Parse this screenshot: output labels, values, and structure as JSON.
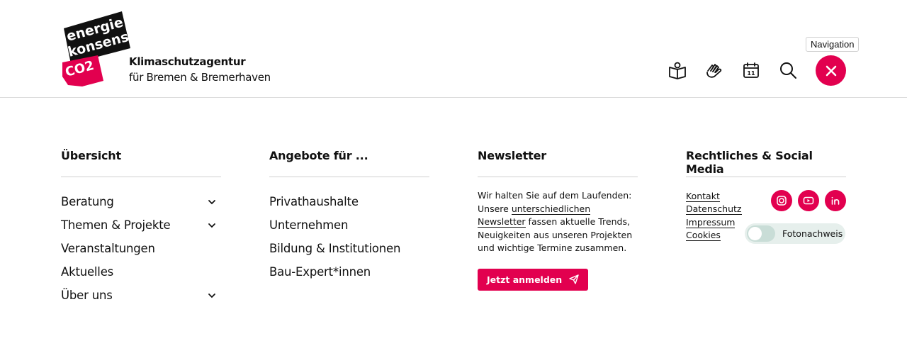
{
  "header": {
    "logo": {
      "line1": "energie",
      "line2": "konsens",
      "mark": "CO2"
    },
    "agency_line1": "Klimaschutzagentur",
    "agency_line2": "für Bremen & Bremerhaven",
    "tooltip": "Navigation",
    "icons": [
      "book-map-icon",
      "hands-icon",
      "calendar-icon",
      "search-icon",
      "close-icon"
    ],
    "calendar_day": "11"
  },
  "columns": {
    "overview": {
      "title": "Übersicht",
      "items": [
        {
          "label": "Beratung",
          "has_submenu": true
        },
        {
          "label": "Themen & Projekte",
          "has_submenu": true
        },
        {
          "label": "Veranstaltungen",
          "has_submenu": false
        },
        {
          "label": "Aktuelles",
          "has_submenu": false
        },
        {
          "label": "Über uns",
          "has_submenu": true
        }
      ]
    },
    "offers": {
      "title": "Angebote für ...",
      "items": [
        {
          "label": "Privathaushalte"
        },
        {
          "label": "Unternehmen"
        },
        {
          "label": "Bildung & Institutionen"
        },
        {
          "label": "Bau-Expert*innen"
        }
      ]
    },
    "newsletter": {
      "title": "Newsletter",
      "text_before": "Wir halten Sie auf dem Laufenden: Unsere ",
      "link": "unterschiedlichen Newsletter",
      "text_after": " fassen aktuelle Trends, Neuigkeiten aus unseren Projekten und wichtige Termine zusammen.",
      "button": "Jetzt anmelden"
    },
    "legal": {
      "title": "Rechtliches & Social Media",
      "links": [
        "Kontakt",
        "Datenschutz",
        "Impressum",
        "Cookies"
      ],
      "socials": [
        "instagram-icon",
        "youtube-icon",
        "linkedin-icon"
      ],
      "toggle_label": "Fotonachweis",
      "toggle_on": false
    }
  },
  "colors": {
    "accent": "#e2004f",
    "text": "#111111",
    "rule": "#cfcfcf",
    "toggle_bg": "#e6efec"
  }
}
